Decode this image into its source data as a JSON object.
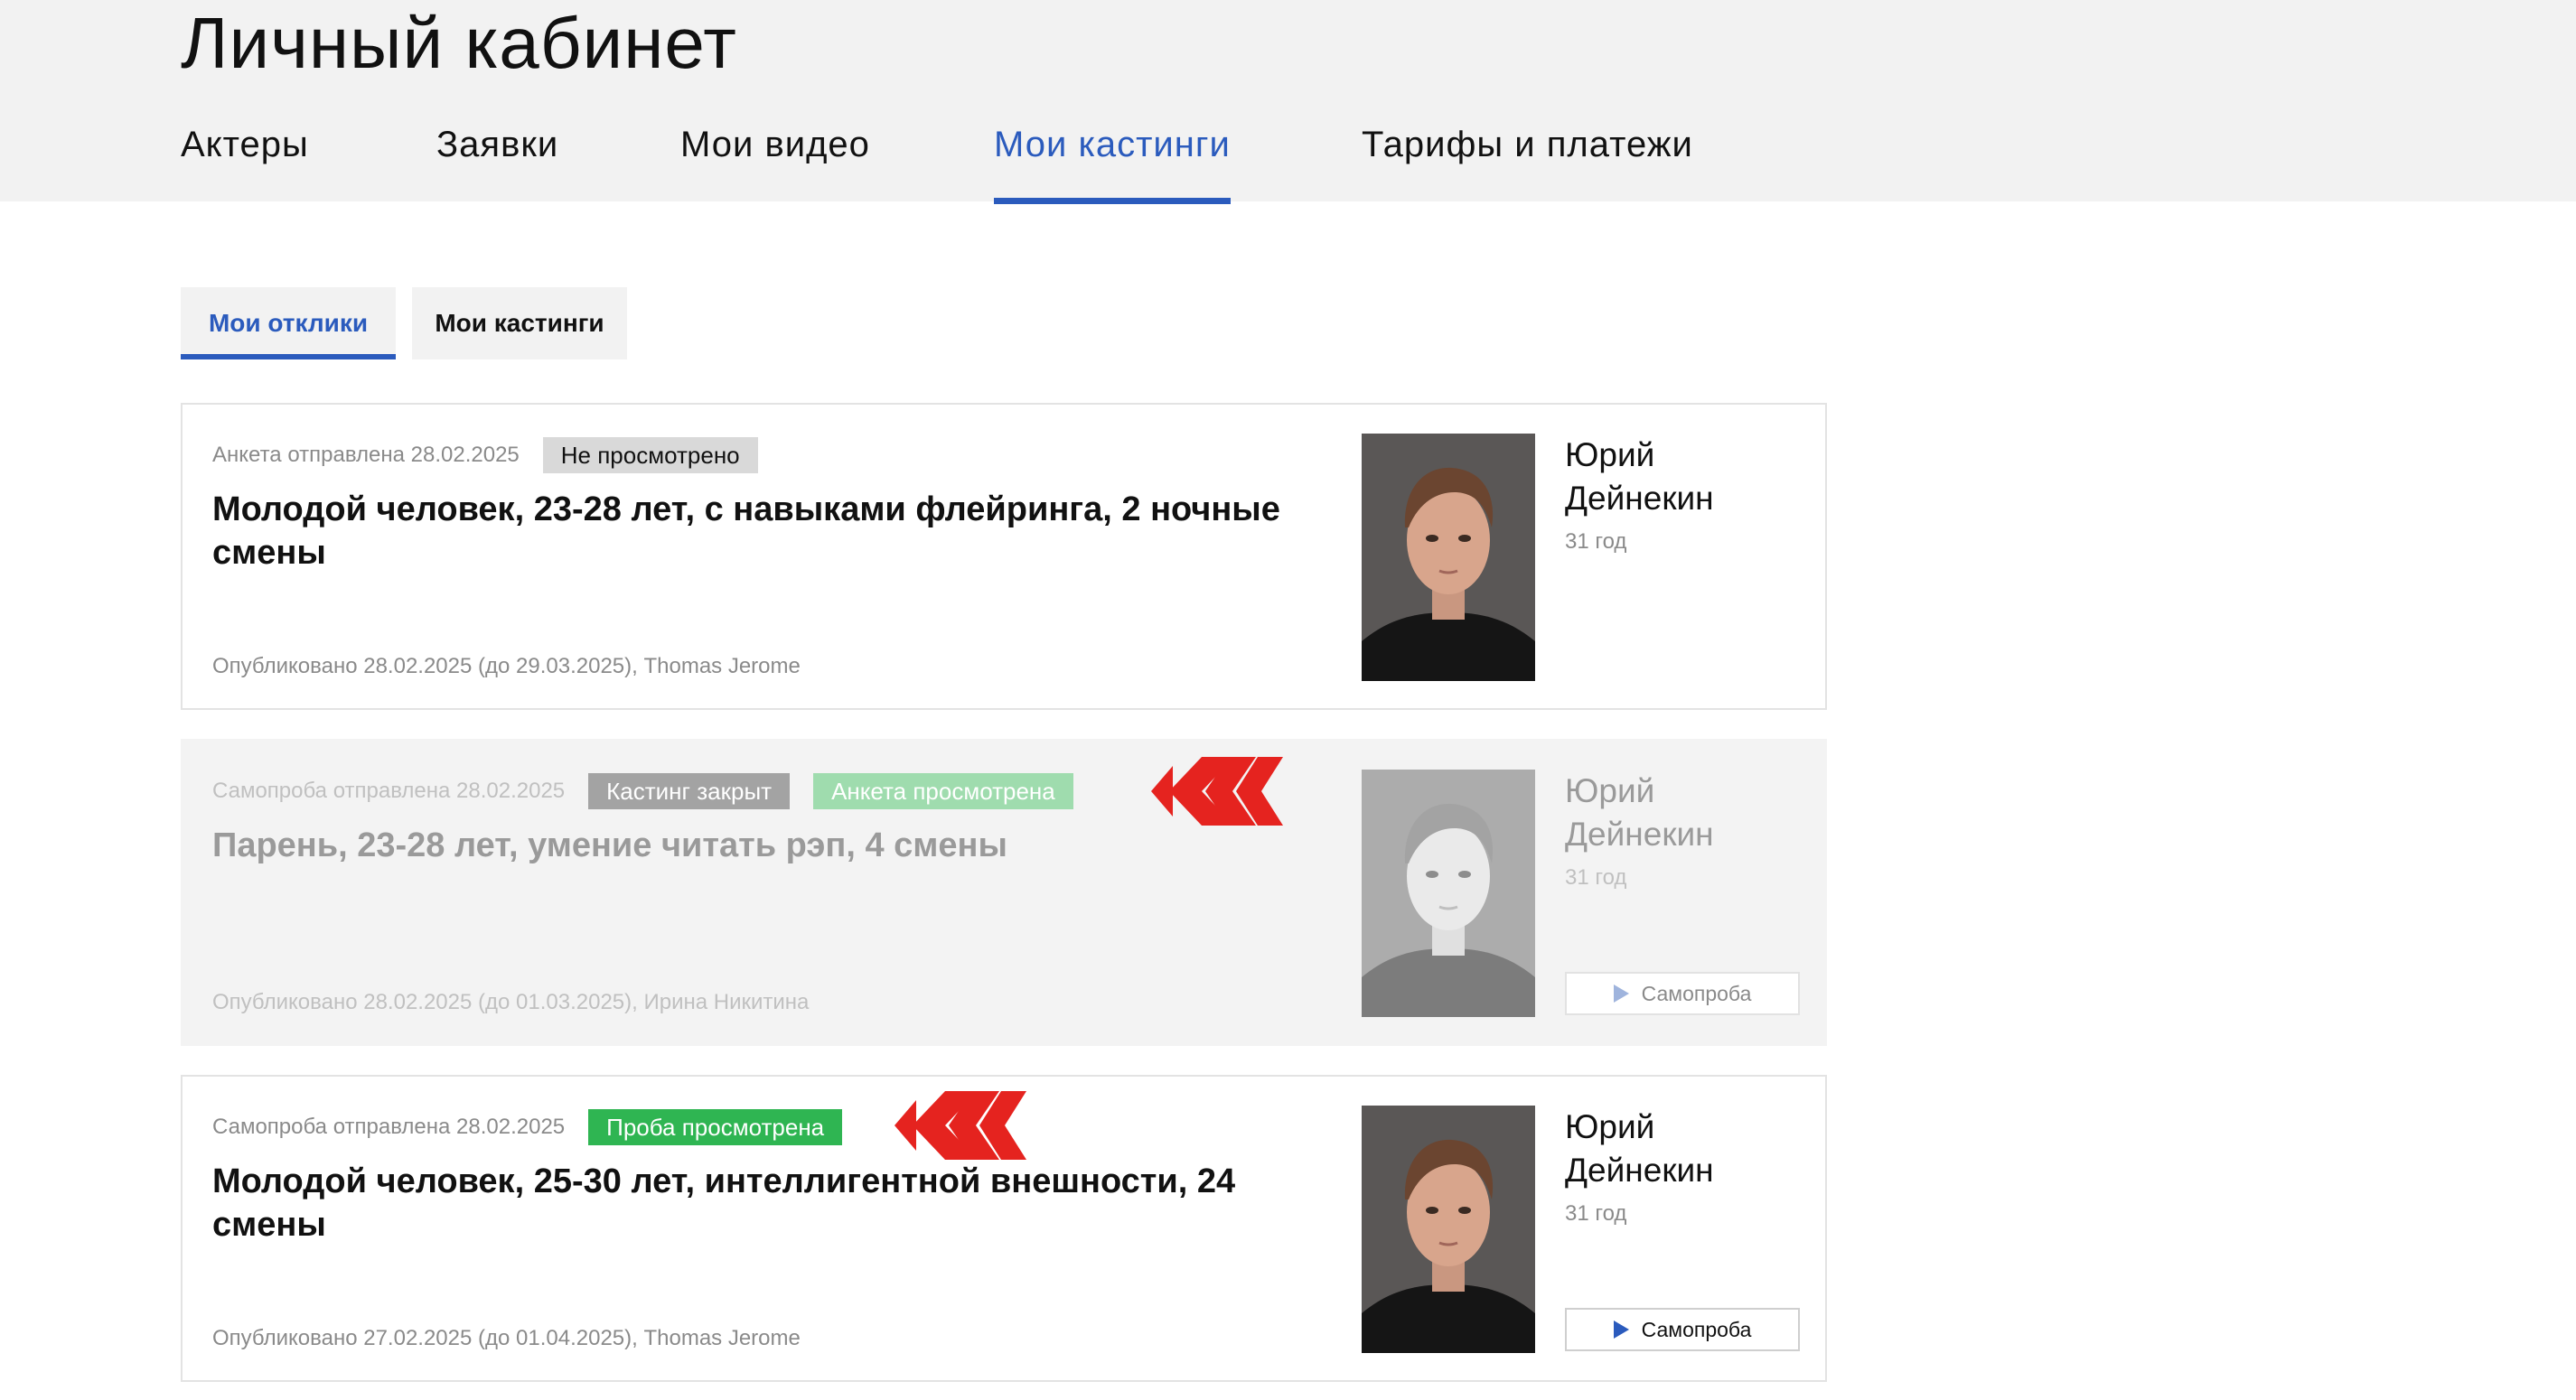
{
  "page": {
    "title": "Личный кабинет"
  },
  "nav": {
    "items": [
      {
        "label": "Актеры"
      },
      {
        "label": "Заявки"
      },
      {
        "label": "Мои видео"
      },
      {
        "label": "Мои кастинги",
        "active": true
      },
      {
        "label": "Тарифы и платежи"
      }
    ]
  },
  "subtabs": [
    {
      "label": "Мои отклики",
      "active": true
    },
    {
      "label": "Мои кастинги"
    }
  ],
  "cards": [
    {
      "sent": "Анкета отправлена 28.02.2025",
      "badges": [
        "Не просмотрено"
      ],
      "title": "Молодой человек, 23-28 лет, с навыками флейринга, 2 ночные смены",
      "published": "Опубликовано 28.02.2025 (до 29.03.2025), Thomas Jerome",
      "actor_name": "Юрий Дейнекин",
      "actor_age": "31 год"
    },
    {
      "sent": "Самопроба отправлена 28.02.2025",
      "badges": [
        "Кастинг закрыт",
        "Анкета просмотрена"
      ],
      "title": "Парень, 23-28 лет, умение читать рэп, 4 смены",
      "published": "Опубликовано 28.02.2025 (до 01.03.2025), Ирина Никитина",
      "actor_name": "Юрий Дейнекин",
      "actor_age": "31 год",
      "button": "Самопроба"
    },
    {
      "sent": "Самопроба отправлена 28.02.2025",
      "badges": [
        "Проба просмотрена"
      ],
      "title": "Молодой человек, 25-30 лет, интеллигентной внешности, 24 смены",
      "published": "Опубликовано 27.02.2025 (до 01.04.2025), Thomas Jerome",
      "actor_name": "Юрий Дейнекин",
      "actor_age": "31 год",
      "button": "Самопроба"
    }
  ],
  "colors": {
    "accent": "#2b5bbd",
    "arrow": "#e5231f",
    "badge_viewed": "#2fb552",
    "badge_closed": "#a3a3a3"
  },
  "icons": [
    "chevron-arrows-icon",
    "play-icon"
  ]
}
